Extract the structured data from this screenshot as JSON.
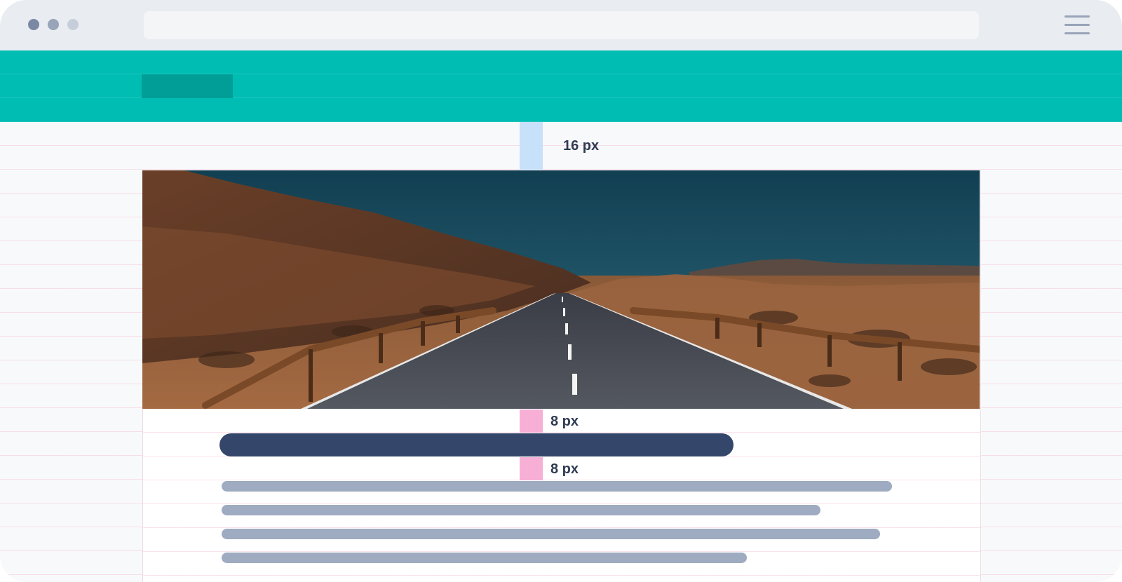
{
  "browser": {
    "window_controls": [
      "window-dot-1",
      "window-dot-2",
      "window-dot-3"
    ],
    "window_dot_colors": [
      "#7b88a3",
      "#98a4b8",
      "#c7cedb"
    ],
    "address_bar_text": "",
    "menu_icon": "hamburger-menu-icon"
  },
  "site_header": {
    "background_color": "#00bdb3",
    "logo_placeholder_color": "#009e97"
  },
  "spacing": {
    "top_gap_label": "16 px",
    "image_to_title_label": "8 px",
    "title_to_text_label": "8 px",
    "top_gap_color": "#c8e1fb",
    "small_gap_color": "#f8afd6"
  },
  "hero_image": {
    "description_icon": "road-landscape-image"
  },
  "text_placeholders": {
    "title_color": "#34476a",
    "body_line_color": "#9eabc0",
    "body_line_count": 4
  }
}
